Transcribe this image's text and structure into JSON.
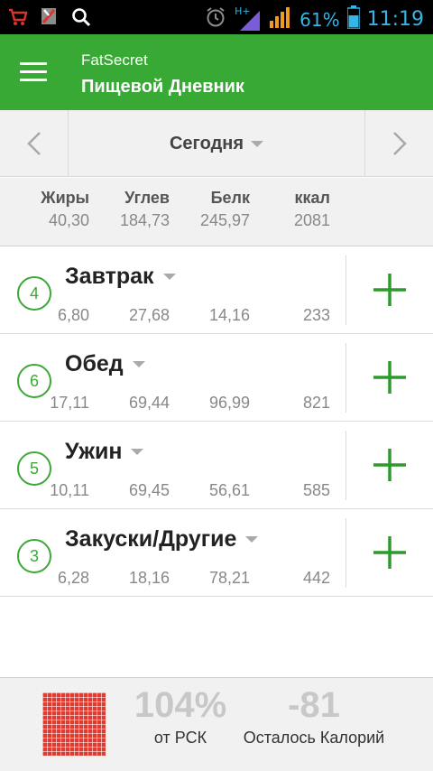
{
  "status_bar": {
    "battery_percent": "61%",
    "time": "11:19",
    "network_label": "H+"
  },
  "app_bar": {
    "app_name": "FatSecret",
    "title": "Пищевой Дневник"
  },
  "date_nav": {
    "label": "Сегодня"
  },
  "summary": {
    "columns": [
      {
        "label": "Жиры",
        "value": "40,30"
      },
      {
        "label": "Углев",
        "value": "184,73"
      },
      {
        "label": "Белк",
        "value": "245,97"
      },
      {
        "label": "ккал",
        "value": "2081"
      }
    ]
  },
  "meals": [
    {
      "name": "Завтрак",
      "count": "4",
      "fat": "6,80",
      "carbs": "27,68",
      "protein": "14,16",
      "kcal": "233"
    },
    {
      "name": "Обед",
      "count": "6",
      "fat": "17,11",
      "carbs": "69,44",
      "protein": "96,99",
      "kcal": "821"
    },
    {
      "name": "Ужин",
      "count": "5",
      "fat": "10,11",
      "carbs": "69,45",
      "protein": "56,61",
      "kcal": "585"
    },
    {
      "name": "Закуски/Другие",
      "count": "3",
      "fat": "6,28",
      "carbs": "18,16",
      "protein": "78,21",
      "kcal": "442"
    }
  ],
  "footer": {
    "rdi_percent": "104%",
    "rdi_label": "от РСК",
    "remaining_calories": "-81",
    "remaining_label": "Осталось Калорий"
  },
  "colors": {
    "brand_green": "#39a935",
    "accent_blue": "#33b5e5",
    "rdi_red": "#e23a2e"
  },
  "icons": {
    "status_left": [
      "cart-icon",
      "flag-icon",
      "search-icon"
    ],
    "status_right": [
      "alarm-icon",
      "signal-icon",
      "signal-icon",
      "battery-icon"
    ],
    "app_bar": "menu-icon",
    "date_nav": [
      "chevron-left-icon",
      "chevron-down-icon",
      "chevron-right-icon"
    ],
    "meal": [
      "chevron-down-icon",
      "plus-icon"
    ],
    "footer": "rdi-grid-icon"
  }
}
